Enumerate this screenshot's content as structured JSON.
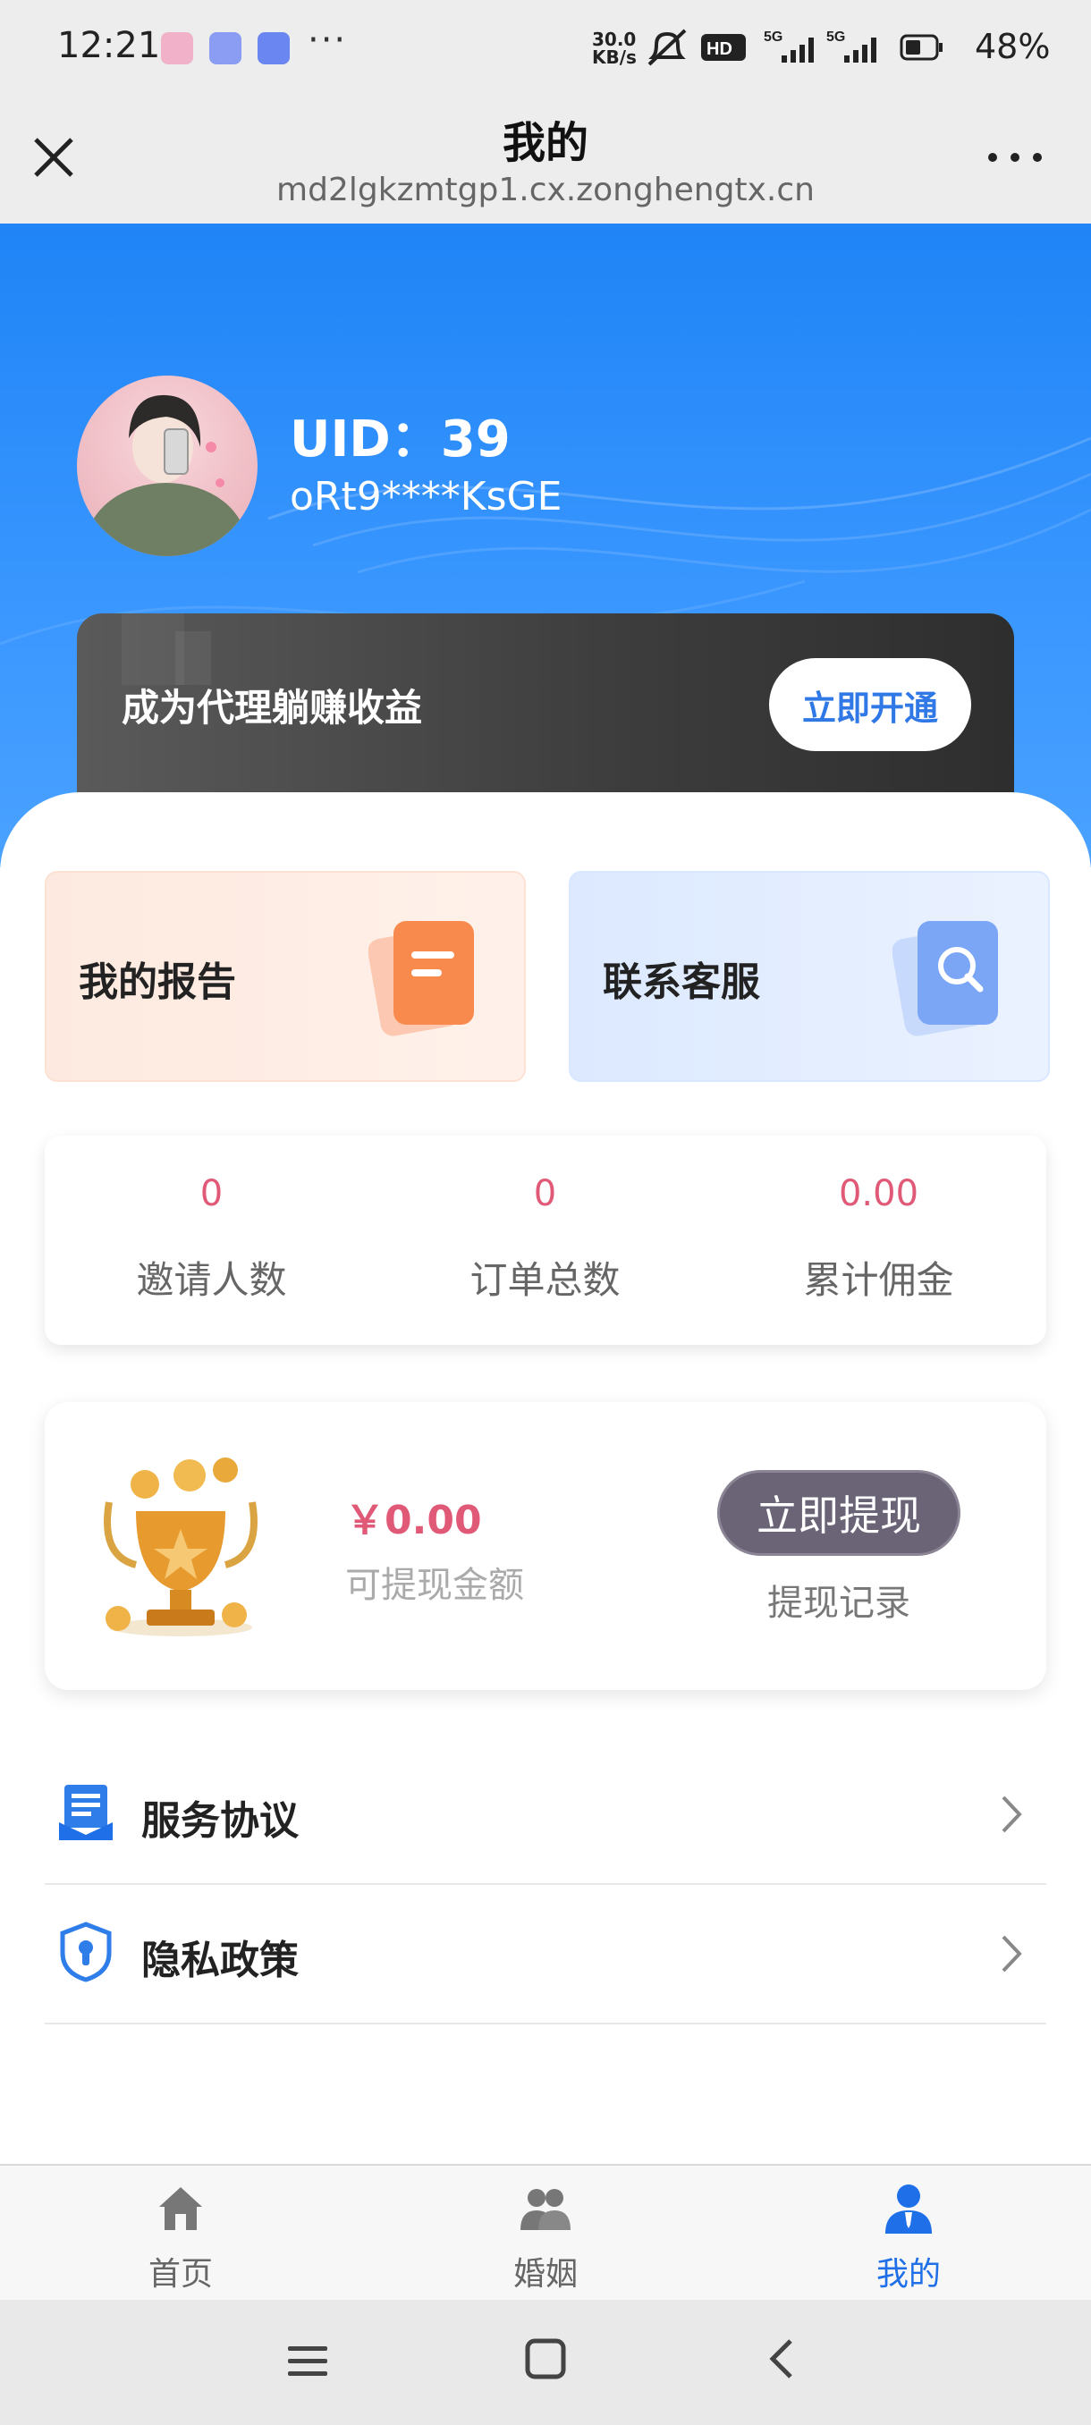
{
  "status_bar": {
    "time": "12:21",
    "net_speed_top": "30.0",
    "net_speed_bottom": "KB/s",
    "battery": "48%"
  },
  "browser": {
    "title": "我的",
    "url": "md2lgkzmtgp1.cx.zonghengtx.cn"
  },
  "profile": {
    "uid_text": "UID：39",
    "username": "oRt9****KsGE"
  },
  "agent_banner": {
    "text": "成为代理躺赚收益",
    "button": "立即开通"
  },
  "quick_cards": {
    "report": "我的报告",
    "service": "联系客服"
  },
  "stats": [
    {
      "value": "0",
      "label": "邀请人数"
    },
    {
      "value": "0",
      "label": "订单总数"
    },
    {
      "value": "0.00",
      "label": "累计佣金"
    }
  ],
  "wallet": {
    "amount": "￥0.00",
    "label": "可提现金额",
    "withdraw_button": "立即提现",
    "record_link": "提现记录"
  },
  "menu": {
    "agreement": "服务协议",
    "privacy": "隐私政策"
  },
  "tabs": {
    "home": "首页",
    "marriage": "婚姻",
    "mine": "我的"
  },
  "colors": {
    "accent": "#1f6fe8",
    "hero_blue": "#2a8cf8",
    "stat_value": "#e05a78"
  }
}
